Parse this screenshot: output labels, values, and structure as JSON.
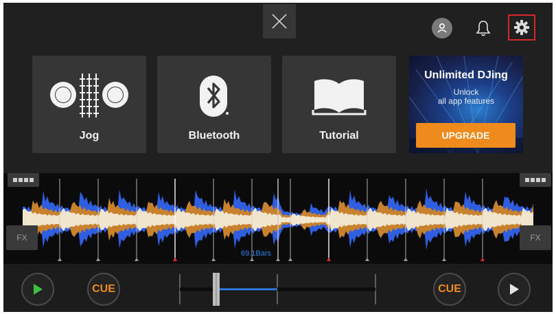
{
  "header": {
    "close_icon": "close-icon",
    "account_icon": "account-icon",
    "bell_icon": "bell-icon",
    "settings_icon": "gear-icon",
    "highlight_color": "#d8262c"
  },
  "tiles": [
    {
      "label": "Jog",
      "icon": "jog-icon"
    },
    {
      "label": "Bluetooth",
      "icon": "bluetooth-icon"
    },
    {
      "label": "Tutorial",
      "icon": "book-icon"
    }
  ],
  "promo": {
    "title": "Unlimited DJing",
    "subtitle_line1": "Unlock",
    "subtitle_line2": "all app features",
    "button_label": "UPGRADE",
    "accent_color": "#ef8a1c"
  },
  "waveform": {
    "fx_left": "FX",
    "fx_right": "FX",
    "bars_label": "69.1Bars",
    "blue_color": "#2f5fe0",
    "orange_color": "#c8822e"
  },
  "transport": {
    "cue_left": "CUE",
    "cue_right": "CUE",
    "play_left_icon": "play-icon",
    "play_right_icon": "play-icon",
    "play_left_color": "#3fbf3f",
    "cue_color": "#f08a24",
    "crossfader_color": "#2f7fe6"
  }
}
